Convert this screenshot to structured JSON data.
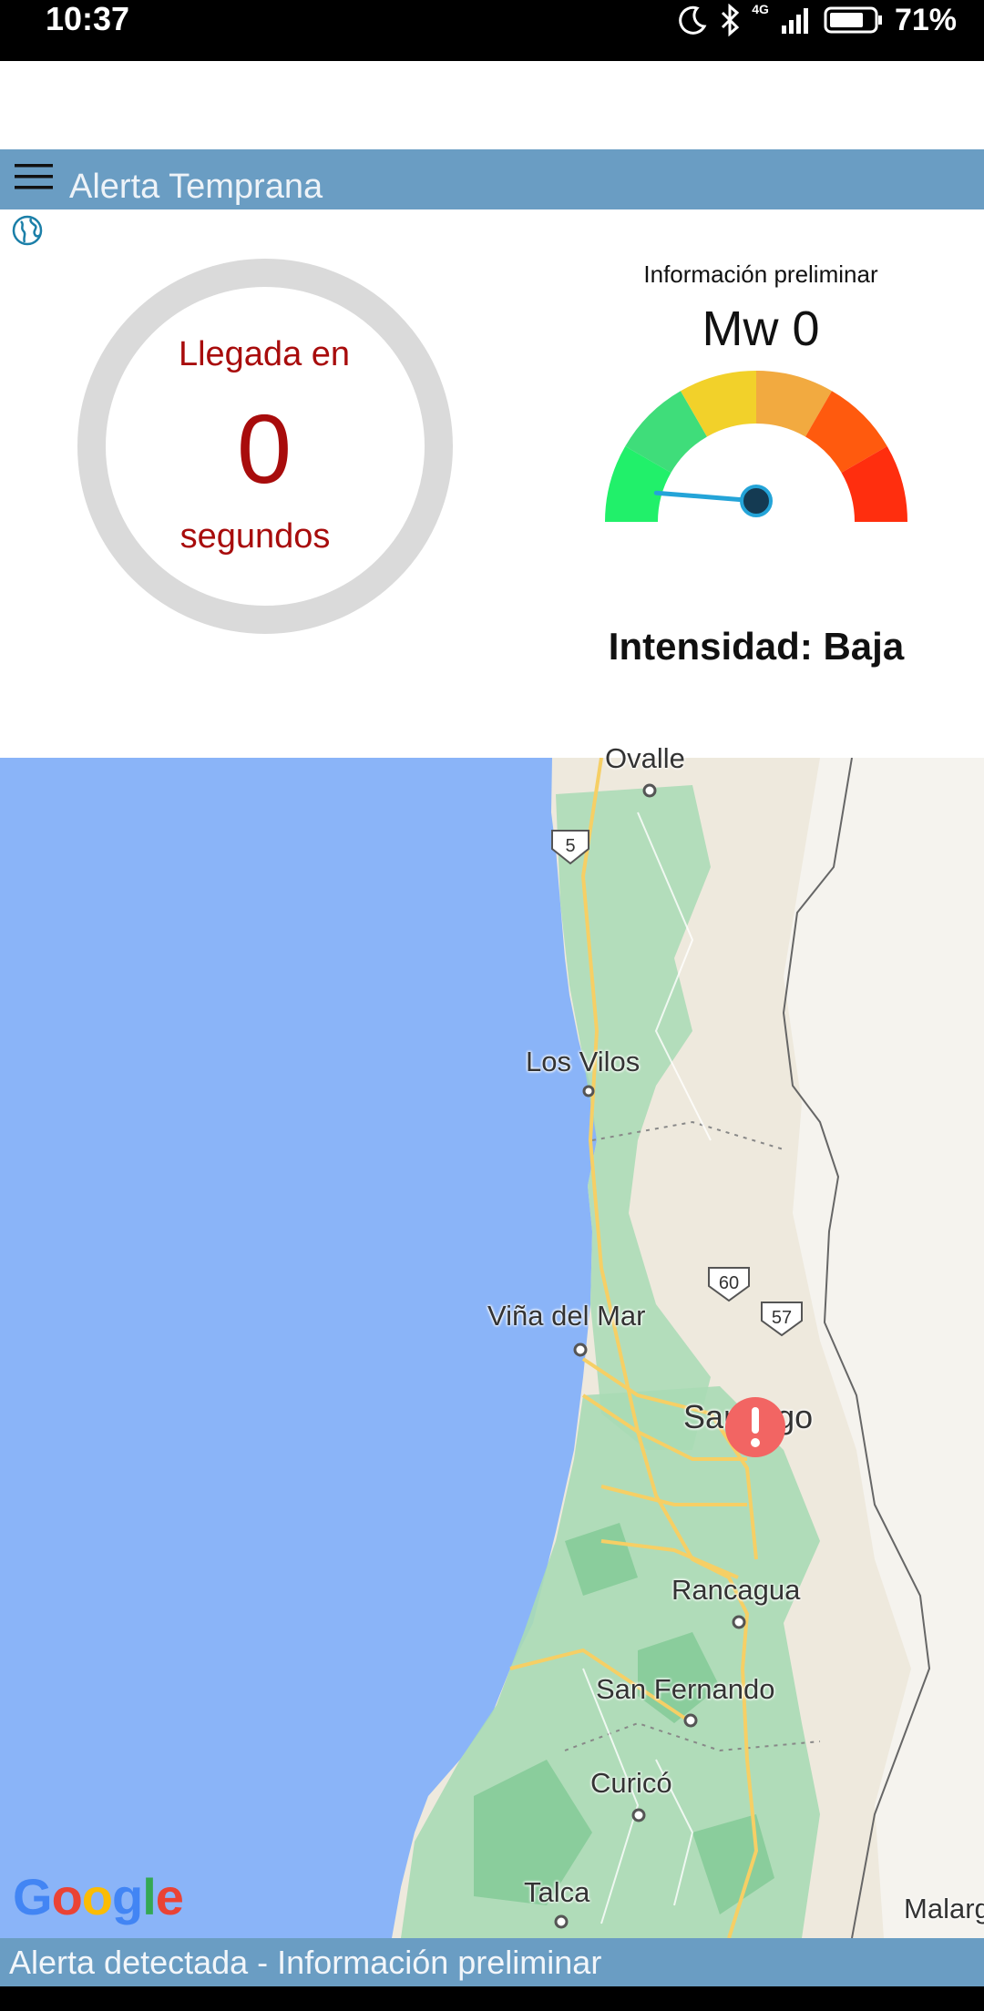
{
  "status_bar": {
    "time": "10:37",
    "network": "4G",
    "battery": "71%",
    "icons": [
      "moon-icon",
      "bluetooth-icon",
      "signal-icon",
      "battery-icon"
    ]
  },
  "app_bar": {
    "title": "Alerta Temprana",
    "menu_icon": "hamburger-menu-icon"
  },
  "globe_icon": "globe-icon",
  "countdown": {
    "label": "Llegada en",
    "value": "0",
    "unit": "segundos"
  },
  "magnitude_panel": {
    "label": "Información preliminar",
    "value": "Mw 0",
    "gauge_level": 0,
    "gauge_colors": [
      "#21f06a",
      "#3fdd7a",
      "#f2d12a",
      "#f2aa40",
      "#ff5a0e",
      "#ff2e0e"
    ],
    "intensity": "Intensidad: Baja"
  },
  "map": {
    "cities": {
      "ovalle": "Ovalle",
      "los_vilos": "Los Vilos",
      "vina_del_mar": "Viña del Mar",
      "santiago": "Santiago",
      "rancagua": "Rancagua",
      "san_fernando": "San Fernando",
      "curico": "Curicó",
      "talca": "Talca",
      "malargue": "Malarg"
    },
    "routes": {
      "r5": "5",
      "r60": "60",
      "r57": "57"
    },
    "marker": "alert-marker-icon",
    "attribution": "Google"
  },
  "bottom_bar": {
    "text": "Alerta detectada - Información preliminar"
  }
}
